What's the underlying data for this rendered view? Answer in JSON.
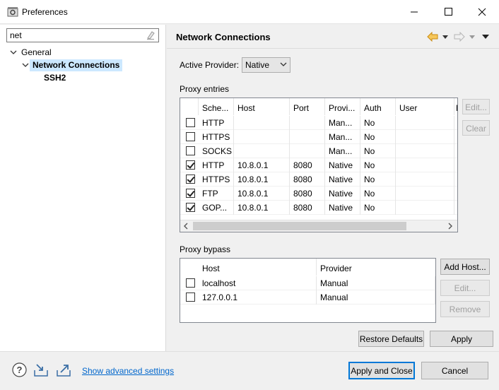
{
  "window": {
    "title": "Preferences",
    "icons": {
      "app": "preferences-gear-icon",
      "minimize": "minimize-icon",
      "maximize": "maximize-icon",
      "close": "close-icon"
    }
  },
  "filter": {
    "value": "net"
  },
  "tree": {
    "items": [
      {
        "label": "General",
        "expanded": true
      },
      {
        "label": "Network Connections",
        "expanded": true,
        "selected": true
      },
      {
        "label": "SSH2"
      }
    ]
  },
  "page": {
    "title": "Network Connections",
    "active_provider_label": "Active Provider:",
    "active_provider_value": "Native"
  },
  "proxy_entries": {
    "label": "Proxy entries",
    "columns": [
      "Sche...",
      "Host",
      "Port",
      "Provi...",
      "Auth",
      "User",
      "P"
    ],
    "rows": [
      {
        "checked": false,
        "scheme": "HTTP",
        "host": "",
        "port": "",
        "provider": "Man...",
        "auth": "No",
        "user": ""
      },
      {
        "checked": false,
        "scheme": "HTTPS",
        "host": "",
        "port": "",
        "provider": "Man...",
        "auth": "No",
        "user": ""
      },
      {
        "checked": false,
        "scheme": "SOCKS",
        "host": "",
        "port": "",
        "provider": "Man...",
        "auth": "No",
        "user": ""
      },
      {
        "checked": true,
        "scheme": "HTTP",
        "host": "10.8.0.1",
        "port": "8080",
        "provider": "Native",
        "auth": "No",
        "user": ""
      },
      {
        "checked": true,
        "scheme": "HTTPS",
        "host": "10.8.0.1",
        "port": "8080",
        "provider": "Native",
        "auth": "No",
        "user": ""
      },
      {
        "checked": true,
        "scheme": "FTP",
        "host": "10.8.0.1",
        "port": "8080",
        "provider": "Native",
        "auth": "No",
        "user": ""
      },
      {
        "checked": true,
        "scheme": "GOP...",
        "host": "10.8.0.1",
        "port": "8080",
        "provider": "Native",
        "auth": "No",
        "user": ""
      }
    ],
    "edit_label": "Edit...",
    "clear_label": "Clear"
  },
  "proxy_bypass": {
    "label": "Proxy bypass",
    "columns": [
      "Host",
      "Provider"
    ],
    "rows": [
      {
        "checked": false,
        "host": "localhost",
        "provider": "Manual"
      },
      {
        "checked": false,
        "host": "127.0.0.1",
        "provider": "Manual"
      }
    ],
    "add_host_label": "Add Host...",
    "edit_label": "Edit...",
    "remove_label": "Remove"
  },
  "buttons": {
    "restore_defaults": "Restore Defaults",
    "apply": "Apply",
    "apply_and_close": "Apply and Close",
    "cancel": "Cancel"
  },
  "footer": {
    "advanced_link": "Show advanced settings"
  },
  "colors": {
    "selection": "#cce8ff",
    "link": "#0066cc",
    "default_button_border": "#0078d7",
    "back_arrow": "#e8a030"
  }
}
